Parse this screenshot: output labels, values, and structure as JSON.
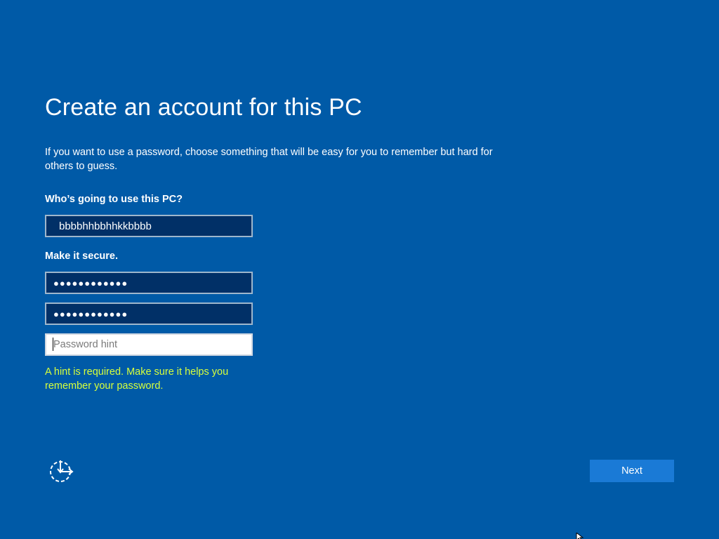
{
  "page": {
    "title": "Create an account for this PC",
    "description": "If you want to use a password, choose something that will be easy for you to remember but hard for others to guess."
  },
  "form": {
    "who_label": "Who’s going to use this PC?",
    "username_value": "bbbbhhbbhhkkbbbb",
    "secure_label": "Make it secure.",
    "password_masked": "●●●●●●●●●●●●",
    "confirm_password_masked": "●●●●●●●●●●●●",
    "hint_placeholder": "Password hint",
    "hint_value": "",
    "hint_error": "A hint is required. Make sure it helps you remember your password."
  },
  "footer": {
    "ease_of_access_icon": "ease-of-access-icon",
    "next_label": "Next"
  },
  "colors": {
    "background": "#005aa7",
    "input_background": "#013067",
    "error_text": "#d7ff3c",
    "button": "#1a7ad6"
  }
}
